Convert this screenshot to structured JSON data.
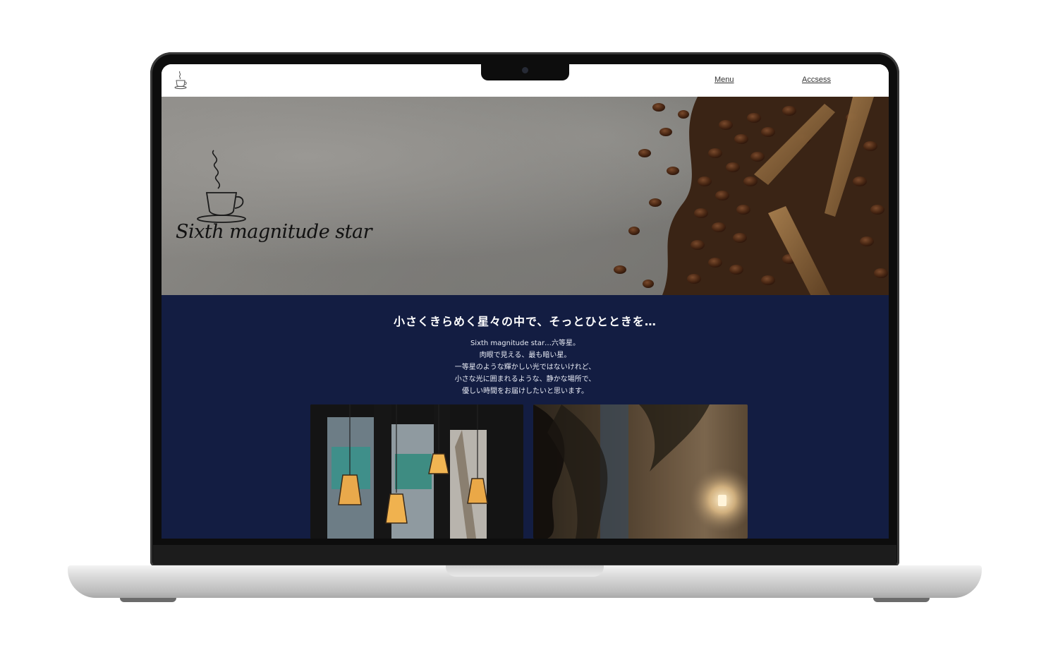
{
  "header": {
    "logo_icon": "coffee-cup-icon",
    "nav": {
      "menu_label": "Menu",
      "access_label": "Accsess"
    }
  },
  "hero": {
    "logo_icon": "coffee-cup-steam-icon",
    "title": "Sixth magnitude star"
  },
  "intro": {
    "heading": "小さくきらめく星々の中で、そっとひとときを…",
    "lines": [
      "Sixth magnitude star…六等星。",
      "肉眼で見える、最も暗い星。",
      "一等星のような輝かしい光ではないけれど、",
      "小さな光に囲まれるような、静かな場所で、",
      "優しい時間をお届けしたいと思います。"
    ],
    "background_color": "#131d42"
  }
}
